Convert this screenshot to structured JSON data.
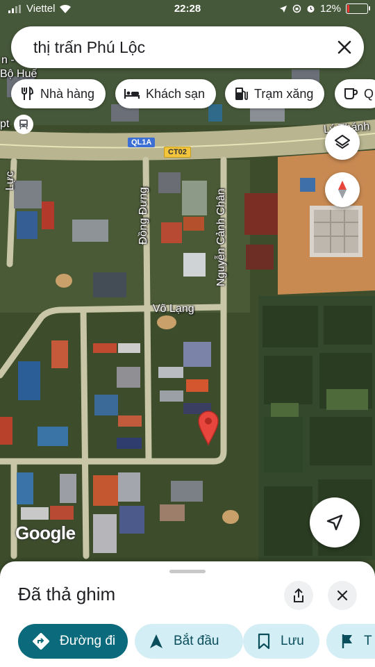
{
  "status_bar": {
    "carrier": "Viettel",
    "time": "22:28",
    "battery_percent": "12%",
    "battery_level": 0.12
  },
  "search": {
    "query": "thị trấn Phú Lộc",
    "close_icon": "close-icon"
  },
  "chips": [
    {
      "label": "Nhà hàng",
      "icon": "restaurant-icon"
    },
    {
      "label": "Khách sạn",
      "icon": "hotel-icon"
    },
    {
      "label": "Trạm xăng",
      "icon": "gas-station-icon"
    },
    {
      "label": "Q",
      "icon": "coffee-icon"
    }
  ],
  "map": {
    "labels": {
      "top_left_1": "n -",
      "top_left_2": "Bộ Huế",
      "top_left_3": "pt",
      "left_road": "Lực",
      "top_right": "Lý Thánh",
      "road_dong_dung": "Đồng Đưng",
      "road_nguyen_canh_chan": "Nguyễn Cảnh Chân",
      "road_vo_lang": "Võ Lạng"
    },
    "shields": {
      "ql": "QL1A",
      "ct": "CT02"
    },
    "google_logo": "Google",
    "colors": {
      "pin": "#e8453c",
      "road": "#c9c6a8"
    }
  },
  "sheet": {
    "title": "Đã thả ghim",
    "actions": [
      {
        "label": "Đường đi",
        "icon": "directions-icon"
      },
      {
        "label": "Bắt đầu",
        "icon": "navigation-arrow-icon"
      },
      {
        "label": "Lưu",
        "icon": "bookmark-icon"
      },
      {
        "label": "T",
        "icon": "flag-icon"
      }
    ]
  },
  "accent_colors": {
    "primary": "#0b6b7c",
    "secondary": "#d4eef5"
  }
}
